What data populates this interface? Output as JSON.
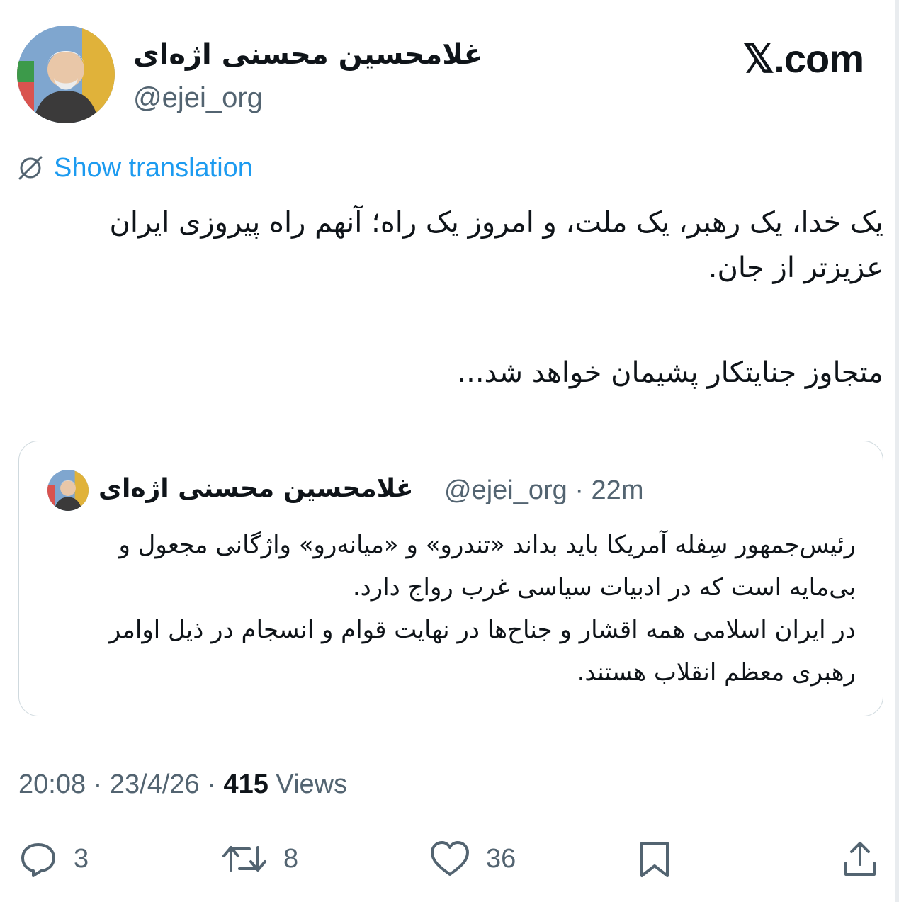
{
  "author": {
    "name": "غلامحسین محسنی اژه‌ای",
    "handle": "@ejei_org"
  },
  "brand": "𝕏.com",
  "translate": {
    "label": "Show translation"
  },
  "tweet": {
    "paragraphs": [
      "یک خدا، یک رهبر، یک ملت، و امروز یک راه؛ آنهم راه پیروزی ایران عزیزتر از جان.",
      "متجاوز جنایتکار پشیمان خواهد شد..."
    ]
  },
  "quote": {
    "name": "غلامحسین محسنی اژه‌ای",
    "handle_time": "@ejei_org · 22m",
    "paragraphs": [
      "رئیس‌جمهور سِفله آمریکا باید بداند «تندرو» و «میانه‌رو» واژگانی مجعول و بی‌مایه است که در ادبیات سیاسی غرب رواج دارد.",
      "در ایران اسلامی همه اقشار و جناح‌ها در نهایت قوام و انسجام در ذیل اوامر رهبری معظم انقلاب هستند."
    ]
  },
  "meta": {
    "time": "20:08",
    "date": "23/4/26",
    "views_count": "415",
    "views_label": "Views",
    "separator": "·"
  },
  "actions": {
    "replies": "3",
    "reposts": "8",
    "likes": "36"
  },
  "colors": {
    "link": "#1d9bf0",
    "secondary_text": "#536471",
    "border": "#cfd9de"
  }
}
